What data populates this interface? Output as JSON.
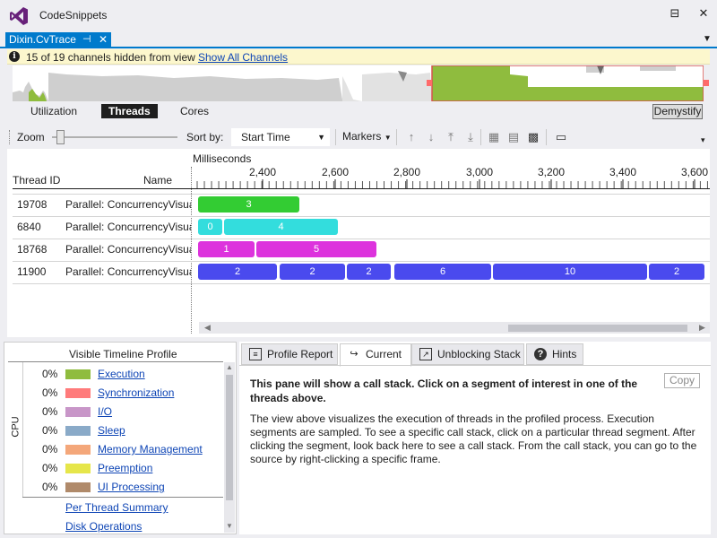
{
  "window": {
    "title": "CodeSnippets",
    "pin_glyph": "⊟",
    "minimize_glyph": "▬",
    "close_glyph": "✕"
  },
  "doc_tab": {
    "label": "Dixin.CvTrace",
    "pin_glyph": "⊣",
    "close_glyph": "✕",
    "dropdown_glyph": "▼"
  },
  "infobar": {
    "icon": "i",
    "message": "15 of 19 channels hidden from view",
    "link": "Show All Channels"
  },
  "overview": {
    "selection_color": "#d9534f",
    "fill_color": "#8fbc3e"
  },
  "view_tabs": [
    {
      "label": "Utilization",
      "active": false
    },
    {
      "label": "Threads",
      "active": true
    },
    {
      "label": "Cores",
      "active": false
    }
  ],
  "demystify_label": "Demystify",
  "toolbar": {
    "zoom_label": "Zoom",
    "sort_label": "Sort by:",
    "sort_value": "Start Time",
    "markers_label": "Markers"
  },
  "grid": {
    "ms_label": "Milliseconds",
    "ticks": [
      "2,400",
      "2,600",
      "2,800",
      "3,000",
      "3,200",
      "3,400",
      "3,600"
    ],
    "col_thread_id": "Thread ID",
    "col_name": "Name",
    "rows": [
      {
        "id": "19708",
        "name": "Parallel: ConcurrencyVisua",
        "segments": [
          {
            "label": "3",
            "color": "#33cc33"
          }
        ]
      },
      {
        "id": "6840",
        "name": "Parallel: ConcurrencyVisua",
        "segments": [
          {
            "label": "0",
            "color": "#33dddd"
          },
          {
            "label": "4",
            "color": "#33dddd"
          }
        ]
      },
      {
        "id": "18768",
        "name": "Parallel: ConcurrencyVisua",
        "segments": [
          {
            "label": "1",
            "color": "#dd33dd"
          },
          {
            "label": "5",
            "color": "#dd33dd"
          }
        ]
      },
      {
        "id": "11900",
        "name": "Parallel: ConcurrencyVisua",
        "segments": [
          {
            "label": "2",
            "color": "#4a4aee"
          },
          {
            "label": "2",
            "color": "#4a4aee"
          },
          {
            "label": "2",
            "color": "#4a4aee"
          },
          {
            "label": "6",
            "color": "#4a4aee"
          },
          {
            "label": "10",
            "color": "#4a4aee"
          },
          {
            "label": "2",
            "color": "#4a4aee"
          }
        ]
      }
    ]
  },
  "profile": {
    "title": "Visible Timeline Profile",
    "axis": "CPU",
    "categories": [
      {
        "pct": "0%",
        "label": "Execution",
        "color": "#8fbc3e"
      },
      {
        "pct": "0%",
        "label": "Synchronization",
        "color": "#ff7b7b"
      },
      {
        "pct": "0%",
        "label": "I/O",
        "color": "#c896c8"
      },
      {
        "pct": "0%",
        "label": "Sleep",
        "color": "#8aaac8"
      },
      {
        "pct": "0%",
        "label": "Memory Management",
        "color": "#f4a77a"
      },
      {
        "pct": "0%",
        "label": "Preemption",
        "color": "#e6e64a"
      },
      {
        "pct": "0%",
        "label": "UI Processing",
        "color": "#b08a6a"
      }
    ],
    "links": [
      "Per Thread Summary",
      "Disk Operations"
    ]
  },
  "right_panel": {
    "tabs": [
      {
        "label": "Profile Report",
        "icon": "report-icon",
        "active": false
      },
      {
        "label": "Current",
        "icon": "callstack-icon",
        "active": true
      },
      {
        "label": "Unblocking Stack",
        "icon": "unblock-icon",
        "active": false
      },
      {
        "label": "Hints",
        "icon": "help-icon",
        "active": false
      }
    ],
    "copy_label": "Copy",
    "bold_text": "This pane will show a call stack. Click on a segment of interest in one of the threads above.",
    "body_text": "The view above visualizes the execution of threads in the profiled process. Execution segments are sampled. To see a specific call stack, click on a particular thread segment. After clicking the segment, look back here to see a call stack. From the call stack, you can go to the source by right-clicking a specific frame."
  }
}
